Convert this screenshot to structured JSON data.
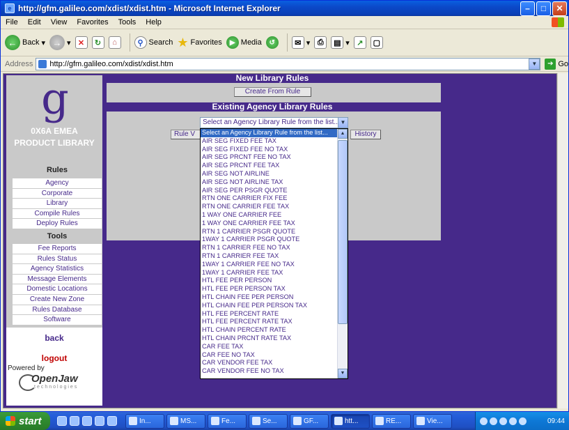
{
  "window": {
    "title": "http://gfm.galileo.com/xdist/xdist.htm - Microsoft Internet Explorer",
    "app_icon_letter": "e"
  },
  "menu": [
    "File",
    "Edit",
    "View",
    "Favorites",
    "Tools",
    "Help"
  ],
  "toolbar": {
    "back": "Back",
    "search": "Search",
    "favorites": "Favorites",
    "media": "Media"
  },
  "address": {
    "label": "Address",
    "url": "http://gfm.galileo.com/xdist/xdist.htm",
    "go": "Go"
  },
  "sidebar": {
    "logo_letter": "g",
    "library_title_line1": "0X6A EMEA",
    "library_title_line2": "PRODUCT LIBRARY",
    "rules_header": "Rules",
    "rules_items": [
      "Agency",
      "Corporate",
      "Library",
      "Compile Rules",
      "Deploy Rules"
    ],
    "tools_header": "Tools",
    "tools_items": [
      "Fee Reports",
      "Rules Status",
      "Agency Statistics",
      "Message Elements",
      "Domestic Locations",
      "Create New Zone",
      "Rules Database",
      "Software"
    ],
    "back": "back",
    "logout": "logout",
    "powered_by": "Powered by",
    "openjaw": "OpenJaw",
    "openjaw_sub": "technologies"
  },
  "main": {
    "new_library_heading": "New Library Rules",
    "create_from_rule": "Create From Rule",
    "existing_heading": "Existing Agency Library Rules",
    "rule_button": "Rule V",
    "history_button": "History",
    "select_value": "Select an Agency Library Rule from the list...",
    "options": [
      "Select an Agency Library Rule from the list...",
      "AIR SEG FIXED FEE TAX",
      "AIR SEG FIXED FEE NO TAX",
      "AIR SEG PRCNT FEE NO TAX",
      "AIR SEG PRCNT FEE TAX",
      "AIR SEG NOT AIRLINE",
      "AIR SEG NOT AIRLINE TAX",
      "AIR SEG PER PSGR QUOTE",
      "RTN ONE CARRIER FIX FEE",
      "RTN ONE CARRIER FEE TAX",
      "1 WAY ONE CARRIER FEE",
      "1 WAY ONE CARRIER FEE TAX",
      "RTN 1 CARRIER PSGR QUOTE",
      "1WAY 1 CARRIER PSGR QUOTE",
      "RTN 1 CARRIER FEE NO TAX",
      "RTN 1 CARRIER FEE TAX",
      "1WAY 1 CARRIER FEE NO TAX",
      "1WAY 1 CARRIER FEE TAX",
      "HTL FEE PER PERSON",
      "HTL FEE PER PERSON TAX",
      "HTL CHAIN FEE PER PERSON",
      "HTL CHAIN FEE PER PERSON TAX",
      "HTL FEE PERCENT RATE",
      "HTL FEE PERCENT RATE TAX",
      "HTL CHAIN PERCENT RATE",
      "HTL CHAIN PRCNT RATE TAX",
      "CAR FEE TAX",
      "CAR FEE NO TAX",
      "CAR VENDOR FEE TAX",
      "CAR VENDOR FEE NO TAX"
    ]
  },
  "taskbar": {
    "start": "start",
    "tasks": [
      "In...",
      "MS...",
      "Fe...",
      "Se...",
      "GF...",
      "htt...",
      "RE...",
      "Vie..."
    ],
    "clock": "09:44"
  },
  "colors": {
    "page_purple": "#46298a",
    "panel_gray": "#c9c9c9",
    "logout_red": "#c00000",
    "selected_blue": "#316ac5"
  }
}
